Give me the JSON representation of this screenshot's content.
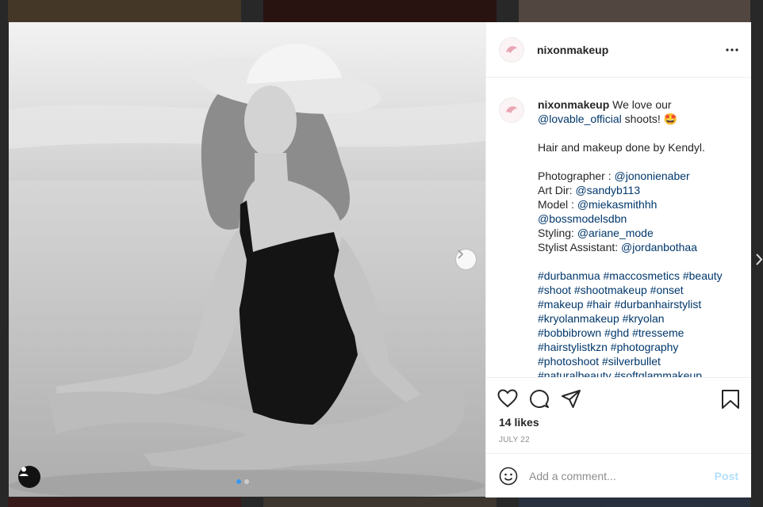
{
  "post": {
    "username": "nixonmakeup",
    "caption": {
      "line1_pre": "We love our",
      "mention1": "@lovable_official",
      "line1_post": " shoots!",
      "emoji": "🤩",
      "line2": "Hair and makeup done by Kendyl.",
      "credits": [
        {
          "label": "Photographer : ",
          "handle": "@jononienaber"
        },
        {
          "label": "Art Dir: ",
          "handle": "@sandyb113"
        },
        {
          "label": "Model : ",
          "handle": "@miekasmithhh"
        },
        {
          "label": "",
          "handle": "@bossmodelsdbn"
        },
        {
          "label": "Styling: ",
          "handle": "@ariane_mode"
        },
        {
          "label": "Stylist Assistant: ",
          "handle": "@jordanbothaa"
        }
      ],
      "hashtag_lines": [
        "#durbanmua #maccosmetics #beauty",
        "#shoot #shootmakeup #onset",
        "#makeup #hair #durbanhairstylist",
        "#kryolanmakeup #kryolan",
        "#bobbibrown #ghd #tresseme",
        "#hairstylistkzn #photography",
        "#photoshoot #silverbullet",
        "#naturalbeauty #softglammakeup"
      ]
    },
    "likes": "14 likes",
    "date": "JULY 22",
    "comment_placeholder": "Add a comment...",
    "post_label": "Post"
  },
  "icons": {
    "more": "more-options-icon",
    "like": "heart-icon",
    "comment": "comment-icon",
    "share": "paper-plane-icon",
    "save": "bookmark-icon",
    "emoji": "emoji-icon",
    "next": "chevron-right-icon",
    "tags": "user-tag-icon"
  },
  "colors": {
    "link": "#00376b",
    "accent": "#3897f0",
    "post_disabled": "#b2dffc",
    "muted": "#8e8e8e"
  }
}
